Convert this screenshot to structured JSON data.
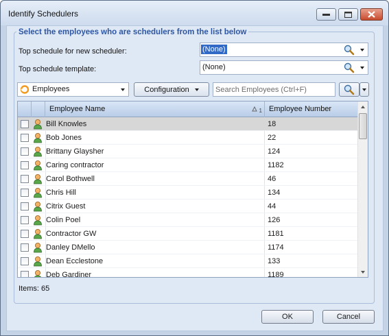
{
  "window": {
    "title": "Identify Schedulers"
  },
  "group": {
    "title": "Select the employees who are schedulers from the list below",
    "top_schedule_label": "Top schedule for new scheduler:",
    "top_schedule_value": "(None)",
    "template_label": "Top schedule template:",
    "template_value": "(None)"
  },
  "toolbar": {
    "view_select": "Employees",
    "configuration_label": "Configuration",
    "search_placeholder": "Search Employees  (Ctrl+F)"
  },
  "grid": {
    "columns": [
      "Employee Name",
      "Employee Number"
    ],
    "sort_indicator": "1",
    "rows": [
      {
        "name": "Bill Knowles",
        "number": "18"
      },
      {
        "name": "Bob Jones",
        "number": "22"
      },
      {
        "name": "Brittany Glaysher",
        "number": "124"
      },
      {
        "name": "Caring contractor",
        "number": "1182"
      },
      {
        "name": "Carol Bothwell",
        "number": "46"
      },
      {
        "name": "Chris Hill",
        "number": "134"
      },
      {
        "name": "Citrix Guest",
        "number": "44"
      },
      {
        "name": "Colin Poel",
        "number": "126"
      },
      {
        "name": "Contractor GW",
        "number": "1181"
      },
      {
        "name": "Danley DMello",
        "number": "1174"
      },
      {
        "name": "Dean Ecclestone",
        "number": "133"
      },
      {
        "name": "Deb Gardiner",
        "number": "1189"
      }
    ]
  },
  "status": {
    "items": "Items: 65"
  },
  "buttons": {
    "ok": "OK",
    "cancel": "Cancel"
  }
}
